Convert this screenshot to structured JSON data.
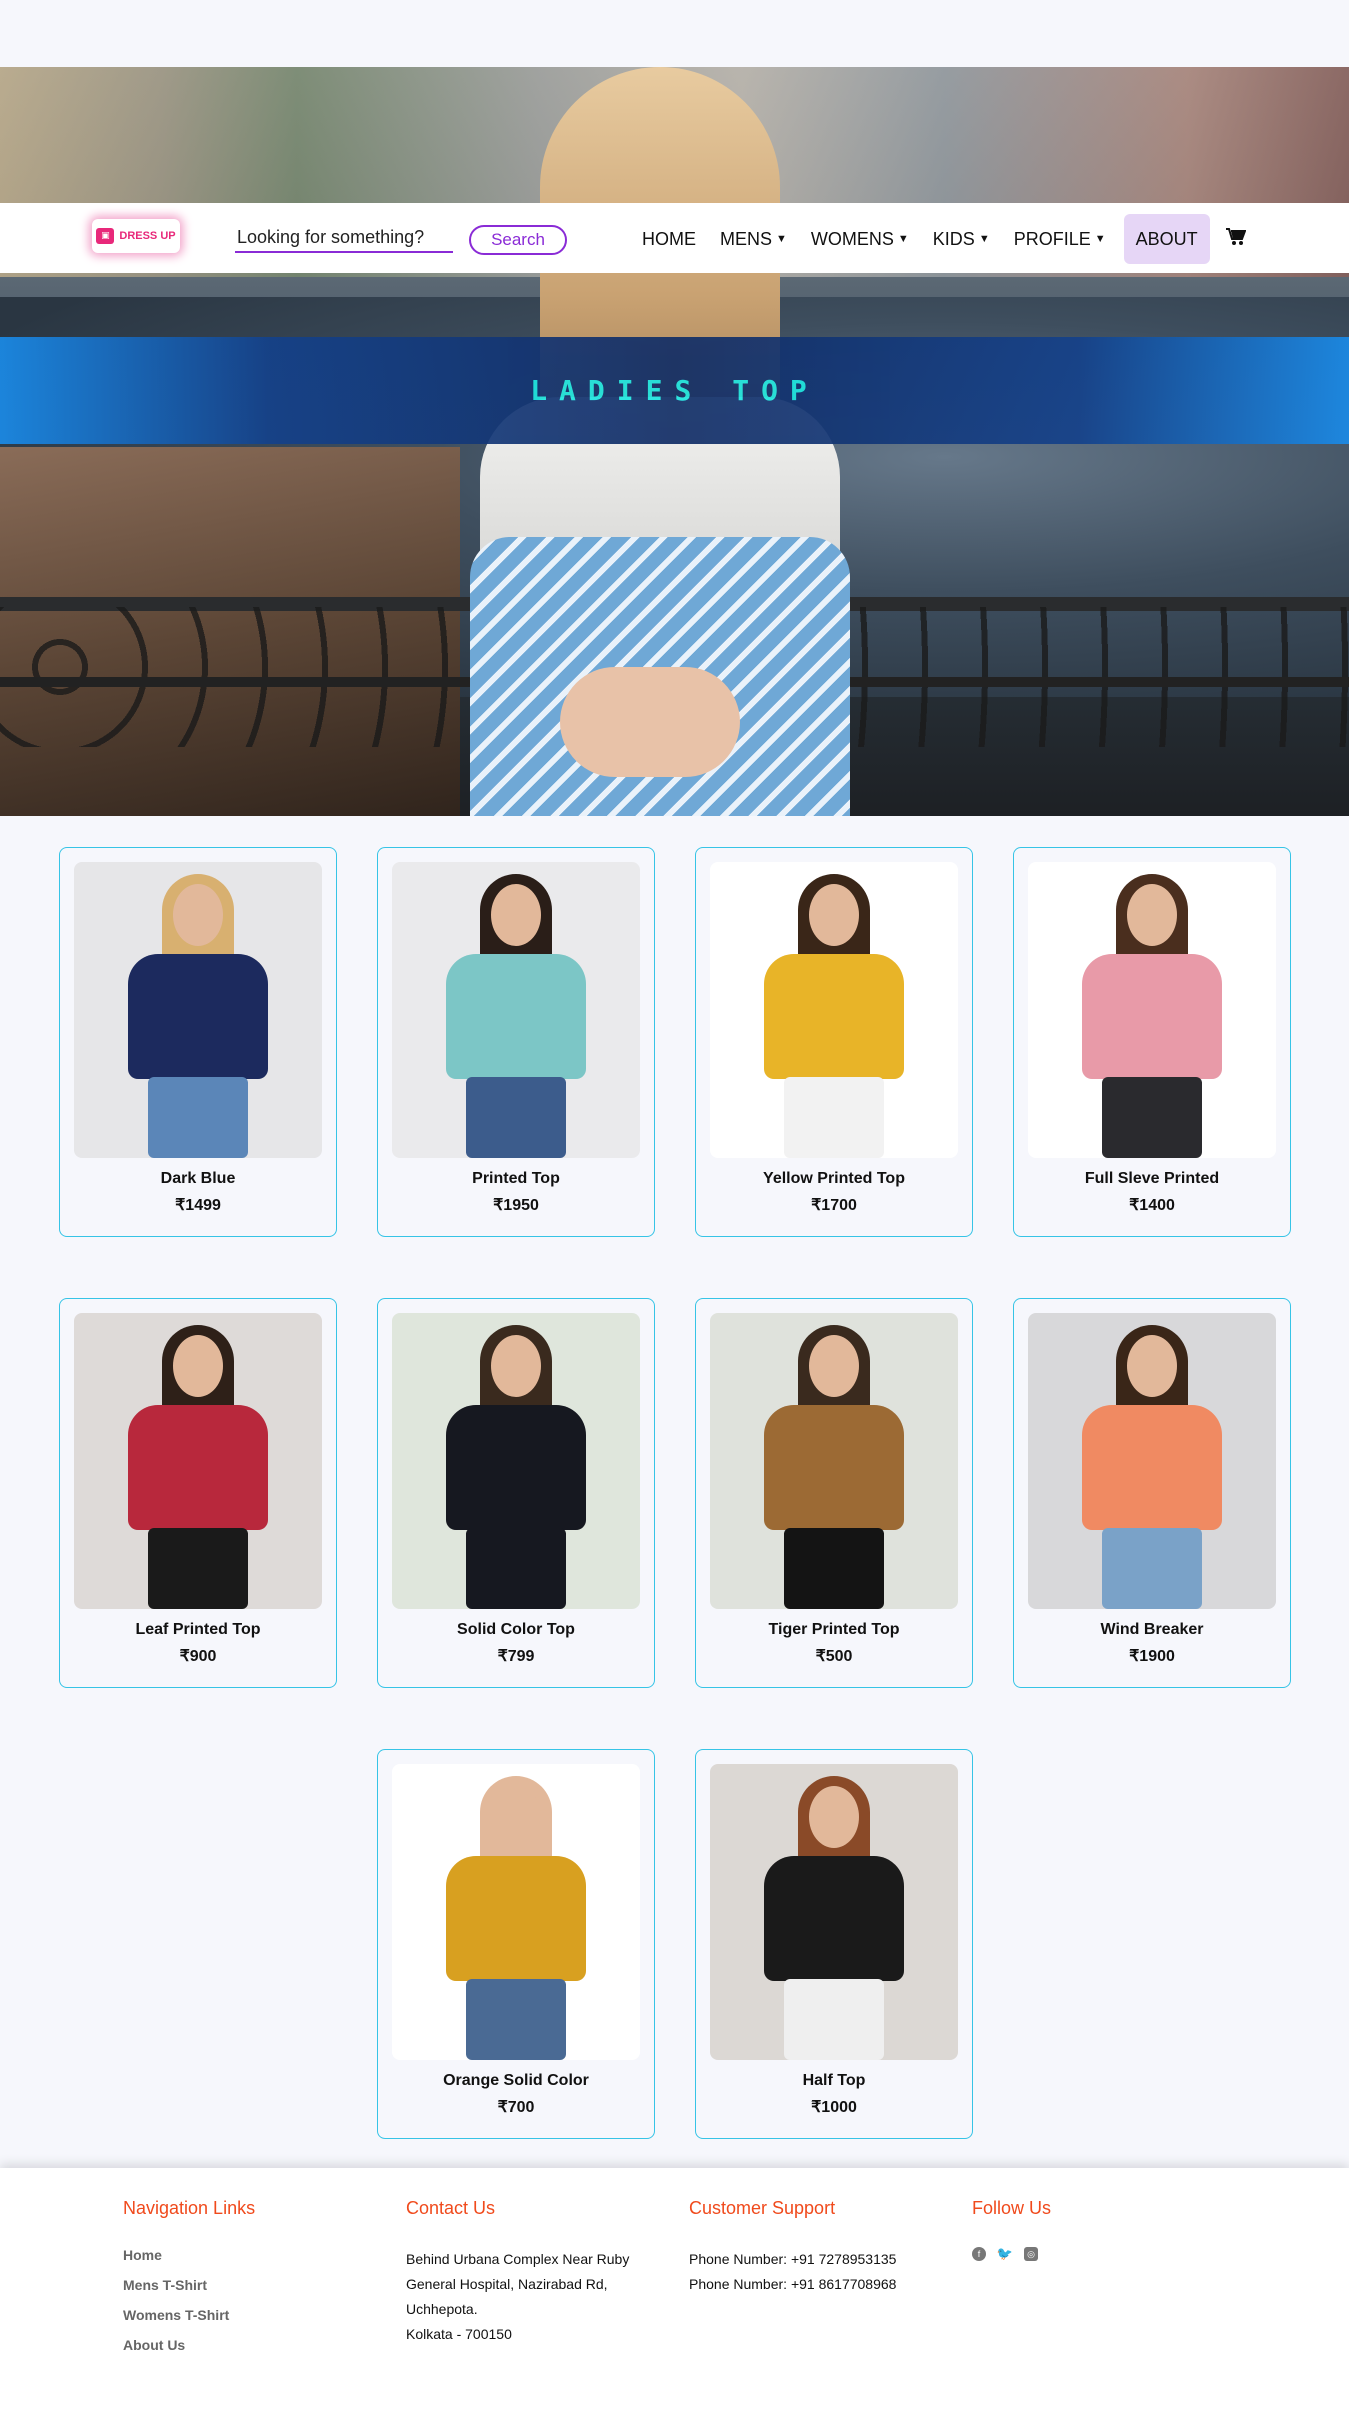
{
  "header": {
    "logo_text": "DRESS UP",
    "search": {
      "placeholder": "Looking for something?",
      "button_label": "Search"
    },
    "menu": [
      {
        "label": "HOME",
        "has_caret": false
      },
      {
        "label": "MENS",
        "has_caret": true
      },
      {
        "label": "WOMENS",
        "has_caret": true
      },
      {
        "label": "KIDS",
        "has_caret": true
      },
      {
        "label": "PROFILE",
        "has_caret": true
      },
      {
        "label": "ABOUT",
        "has_caret": false,
        "active": true
      }
    ],
    "cart_icon": "cart-icon"
  },
  "hero": {
    "title": "LADIES TOP"
  },
  "products": [
    {
      "name": "Dark Blue",
      "price": "₹1499",
      "bg": "#e6e6e8",
      "hair": "#d8b070",
      "top": "#1c2a5e",
      "bottom": "#5b86b8"
    },
    {
      "name": "Printed Top",
      "price": "₹1950",
      "bg": "#eaeaec",
      "hair": "#2a1e18",
      "top": "#7cc6c6",
      "bottom": "#3c5c8c"
    },
    {
      "name": "Yellow Printed Top",
      "price": "₹1700",
      "bg": "#ffffff",
      "hair": "#3a2618",
      "top": "#e8b428",
      "bottom": "#f2f2f2"
    },
    {
      "name": "Full Sleve Printed",
      "price": "₹1400",
      "bg": "#ffffff",
      "hair": "#4a2e1e",
      "top": "#e89aa8",
      "bottom": "#2a2a2e"
    },
    {
      "name": "Leaf Printed Top",
      "price": "₹900",
      "bg": "#dedad8",
      "hair": "#2e2018",
      "top": "#b8283c",
      "bottom": "#1a1a1a"
    },
    {
      "name": "Solid Color Top",
      "price": "₹799",
      "bg": "#dfe6dc",
      "hair": "#3a2a1e",
      "top": "#161820",
      "bottom": "#161820"
    },
    {
      "name": "Tiger Printed Top",
      "price": "₹500",
      "bg": "#dfe2dc",
      "hair": "#3a2a1e",
      "top": "#9c6a34",
      "bottom": "#141414"
    },
    {
      "name": "Wind Breaker",
      "price": "₹1900",
      "bg": "#d8d8da",
      "hair": "#3a2618",
      "top": "#f08a62",
      "bottom": "#7aa2c8"
    },
    {
      "name": "Orange Solid Color",
      "price": "₹700",
      "bg": "#ffffff",
      "hair": "#e2b89a",
      "top": "#d8a020",
      "bottom": "#4a6a94"
    },
    {
      "name": "Half Top",
      "price": "₹1000",
      "bg": "#dcd8d4",
      "hair": "#8a4a28",
      "top": "#1a1a1a",
      "bottom": "#efefef"
    }
  ],
  "footer": {
    "nav": {
      "title": "Navigation Links",
      "links": [
        "Home",
        "Mens T-Shirt",
        "Womens T-Shirt",
        "About Us"
      ]
    },
    "contact": {
      "title": "Contact Us",
      "lines": [
        "Behind Urbana Complex Near Ruby",
        "General Hospital, Nazirabad Rd,",
        "Uchhepota.",
        "Kolkata - 700150"
      ]
    },
    "support": {
      "title": "Customer Support",
      "lines": [
        "Phone Number: +91 7278953135",
        "Phone Number: +91 8617708968"
      ]
    },
    "follow": {
      "title": "Follow Us",
      "icons": [
        "facebook-icon",
        "twitter-icon",
        "instagram-icon"
      ]
    }
  }
}
